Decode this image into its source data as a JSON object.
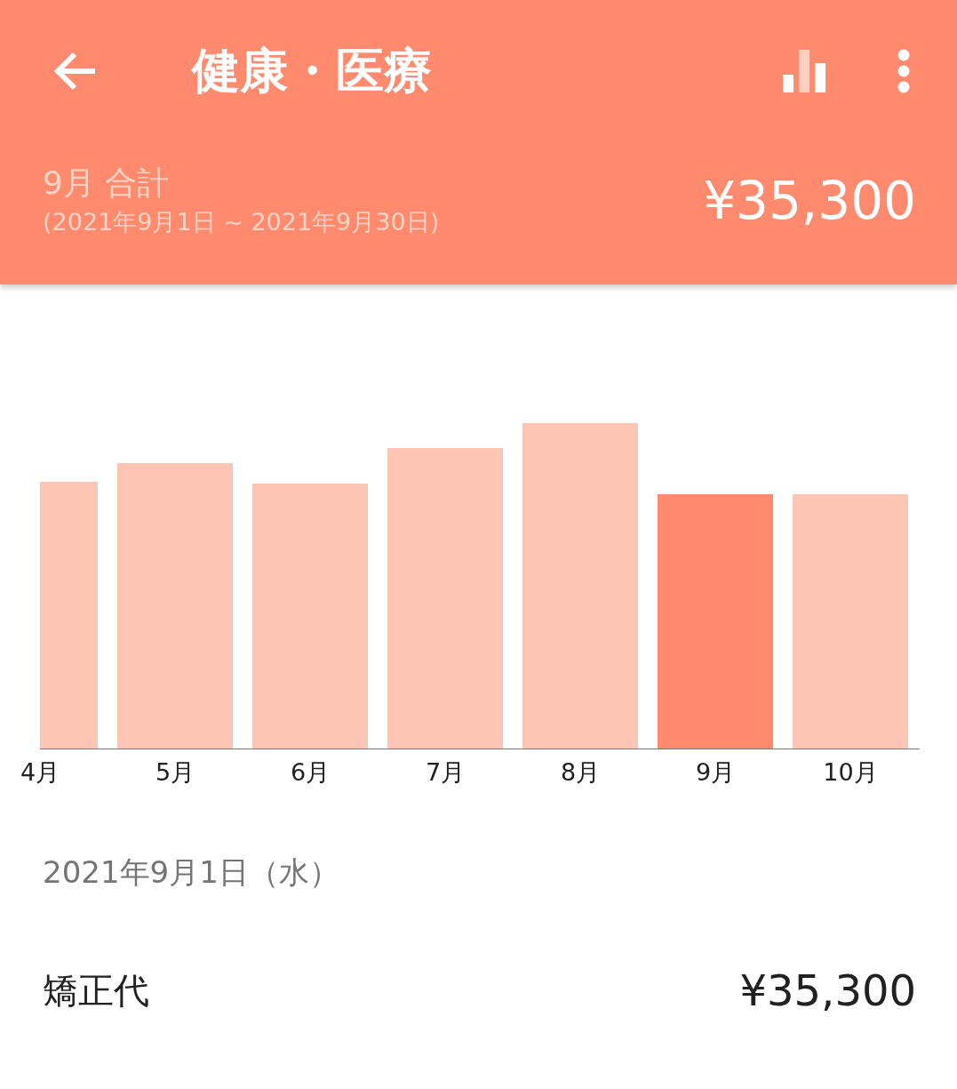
{
  "app_bar": {
    "title": "健康・医療"
  },
  "summary": {
    "period": "9月 合計",
    "range": "(2021年9月1日 ~ 2021年9月30日)",
    "total": "¥35,300"
  },
  "bars": [
    {
      "label": "4月",
      "selected": false
    },
    {
      "label": "5月",
      "selected": false
    },
    {
      "label": "6月",
      "selected": false
    },
    {
      "label": "7月",
      "selected": false
    },
    {
      "label": "8月",
      "selected": false
    },
    {
      "label": "9月",
      "selected": true
    },
    {
      "label": "10月",
      "selected": false
    }
  ],
  "day": {
    "date": "2021年9月1日（水）",
    "entries": [
      {
        "name": "矯正代",
        "amount": "¥35,300"
      }
    ]
  }
}
